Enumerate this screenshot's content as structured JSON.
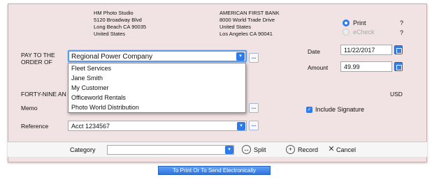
{
  "payer": {
    "name": "HM Photo Studio",
    "street": "5120 Broadway Blvd",
    "city": "Long Beach CA 90035",
    "country": "United States"
  },
  "bank": {
    "name": "AMERICAN FIRST BANK",
    "street": "8000 World Trade Drive",
    "country": "United States",
    "city": "Los Angeles CA 90041"
  },
  "print_mode": {
    "print_label": "Print",
    "echeck_label": "eCheck",
    "help": "?"
  },
  "pay_to": {
    "label_line1": "PAY TO THE",
    "label_line2": "ORDER OF",
    "value": "Regional Power Company",
    "options": [
      "Fleet Services",
      "Jane Smith",
      "My Customer",
      "Officeworld Rentals",
      "Photo World Distribution"
    ]
  },
  "date": {
    "label": "Date",
    "value": "11/22/2017"
  },
  "amount": {
    "label": "Amount",
    "value": "49.99"
  },
  "amount_words": {
    "text": "FORTY-NINE AN",
    "currency": "USD"
  },
  "memo": {
    "label": "Memo",
    "value": ""
  },
  "signature": {
    "label": "Include Signature",
    "checked": true
  },
  "reference": {
    "label": "Reference",
    "value": "Acct 1234567"
  },
  "bottom_bar": {
    "category_label": "Category",
    "category_value": "",
    "split_label": "Split",
    "record_label": "Record",
    "cancel_label": "Cancel"
  },
  "send_button": {
    "label": "To Print Or To Send Electronically"
  },
  "colors": {
    "check_bg": "#f1e3e3",
    "accent": "#2c7cf2"
  },
  "button_glyph": "..."
}
